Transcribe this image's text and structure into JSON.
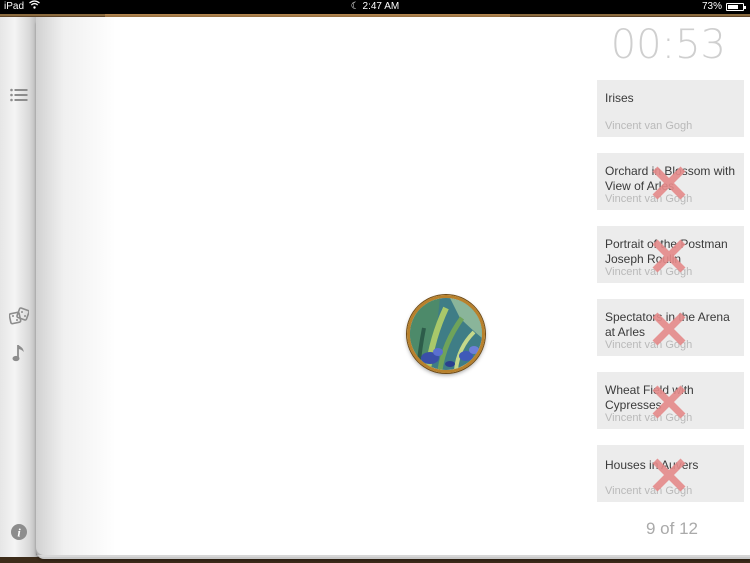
{
  "status_bar": {
    "device": "iPad",
    "time": "2:47 AM",
    "battery": "73%",
    "battery_level": 0.73
  },
  "timer": "00:53",
  "pager": "9 of 12",
  "sidebar": {
    "icons": [
      "list-icon",
      "dice-icon",
      "music-note-icon",
      "info-icon"
    ]
  },
  "painting": {
    "icon": "irises-painting-thumbnail"
  },
  "cards": [
    {
      "title": "Irises",
      "artist": "Vincent van Gogh",
      "crossed": false
    },
    {
      "title": "Orchard in Blossom with View of Arles",
      "artist": "Vincent van Gogh",
      "crossed": true
    },
    {
      "title": "Portrait of the Postman Joseph Roulin",
      "artist": "Vincent van Gogh",
      "crossed": true
    },
    {
      "title": "Spectators in the Arena at Arles",
      "artist": "Vincent van Gogh",
      "crossed": true
    },
    {
      "title": "Wheat Field with Cypresses",
      "artist": "Vincent van Gogh",
      "crossed": true
    },
    {
      "title": "Houses in Auvers",
      "artist": "Vincent van Gogh",
      "crossed": true
    }
  ],
  "colors": {
    "wrong_mark": "#e58a8a",
    "card_bg": "#ececec",
    "frame_gold": "#b8812c"
  }
}
